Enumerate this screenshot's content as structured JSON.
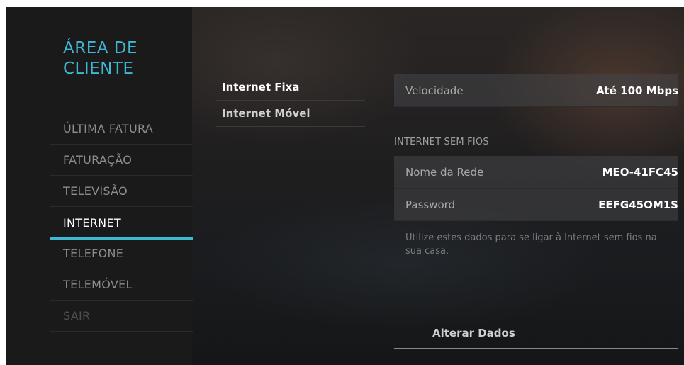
{
  "sidebar": {
    "title": "ÁREA DE\nCLIENTE",
    "items": [
      {
        "label": "ÚLTIMA FATURA"
      },
      {
        "label": "FATURAÇÃO"
      },
      {
        "label": "TELEVISÃO"
      },
      {
        "label": "INTERNET"
      },
      {
        "label": "TELEFONE"
      },
      {
        "label": "TELEMÓVEL"
      },
      {
        "label": "SAIR"
      }
    ]
  },
  "submenu": {
    "items": [
      {
        "label": "Internet Fixa"
      },
      {
        "label": "Internet Móvel"
      }
    ]
  },
  "details": {
    "speed": {
      "label": "Velocidade",
      "value": "Até 100 Mbps"
    },
    "wifi_section": "INTERNET SEM FIOS",
    "network": {
      "label": "Nome da Rede",
      "value": "MEO-41FC45"
    },
    "password": {
      "label": "Password",
      "value": "EEFG45OM1S"
    },
    "note": "Utilize estes dados para se ligar à Internet sem fios na sua casa.",
    "change_button": "Alterar Dados"
  },
  "colors": {
    "accent": "#3fb8d4",
    "sidebar_bg": "#1a1a1b",
    "active_text": "#ffffff",
    "inactive_text": "#8e8e8e"
  }
}
